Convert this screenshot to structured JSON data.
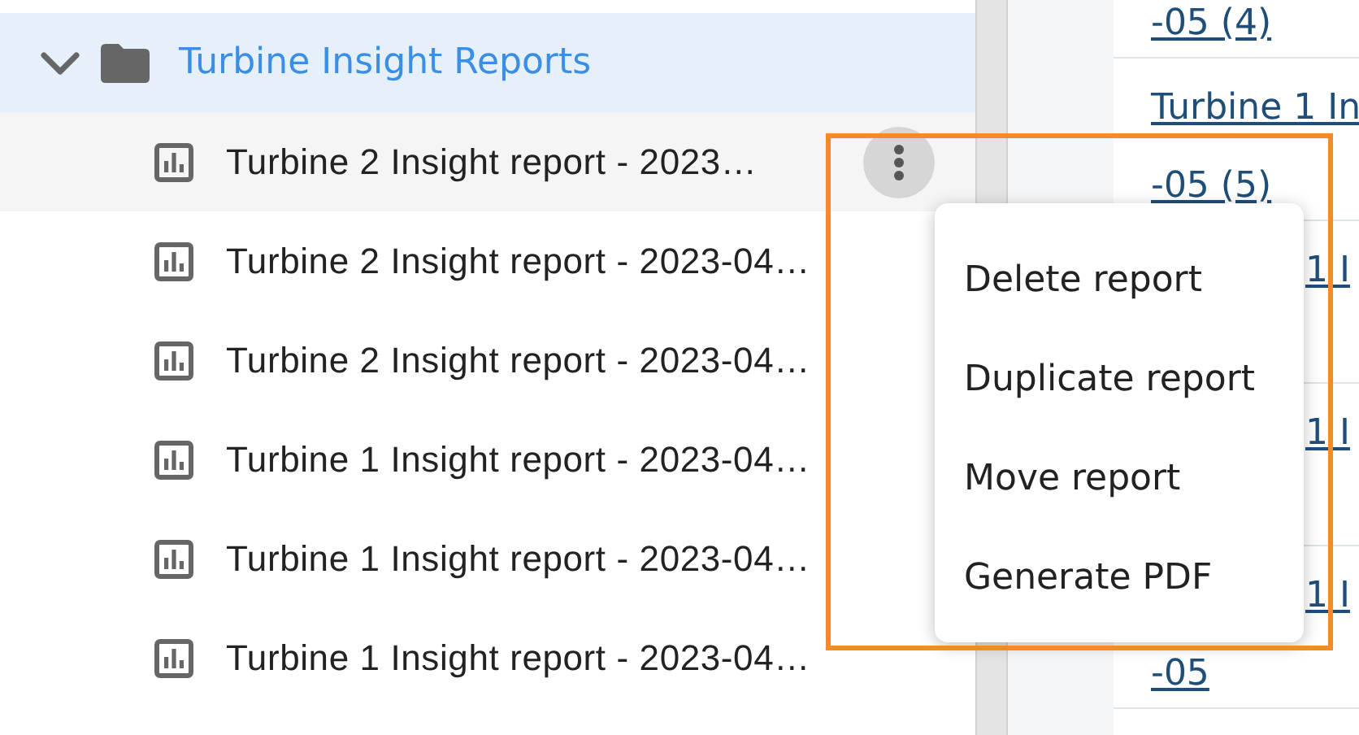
{
  "tree": {
    "folder": {
      "label": "Turbine Insight Reports",
      "expanded": true,
      "selected": true
    },
    "items": [
      {
        "label": "Turbine 2 Insight report - 2023…",
        "selected": true
      },
      {
        "label": "Turbine 2 Insight report - 2023-04…",
        "selected": false
      },
      {
        "label": "Turbine 2 Insight report - 2023-04…",
        "selected": false
      },
      {
        "label": "Turbine 1 Insight report - 2023-04…",
        "selected": false
      },
      {
        "label": "Turbine 1 Insight report - 2023-04…",
        "selected": false
      },
      {
        "label": "Turbine 1 Insight report - 2023-04…",
        "selected": false
      }
    ]
  },
  "context_menu": {
    "items": [
      "Delete report",
      "Duplicate report",
      "Move report",
      "Generate PDF"
    ]
  },
  "table_cells": [
    {
      "lines": [
        {
          "text": "-05 (4)",
          "kind": "full"
        }
      ]
    },
    {
      "lines": [
        {
          "text": "Turbine 1 In",
          "kind": "full"
        },
        {
          "text": "-05 (5)",
          "kind": "full"
        }
      ]
    },
    {
      "lines": [
        {
          "text": "1 I",
          "kind": "tail"
        }
      ]
    },
    {
      "lines": [
        {
          "text": "1 I",
          "kind": "tail"
        }
      ]
    },
    {
      "lines": [
        {
          "text": "1 I",
          "kind": "tail"
        },
        {
          "text": "-05",
          "kind": "full"
        }
      ]
    }
  ]
}
